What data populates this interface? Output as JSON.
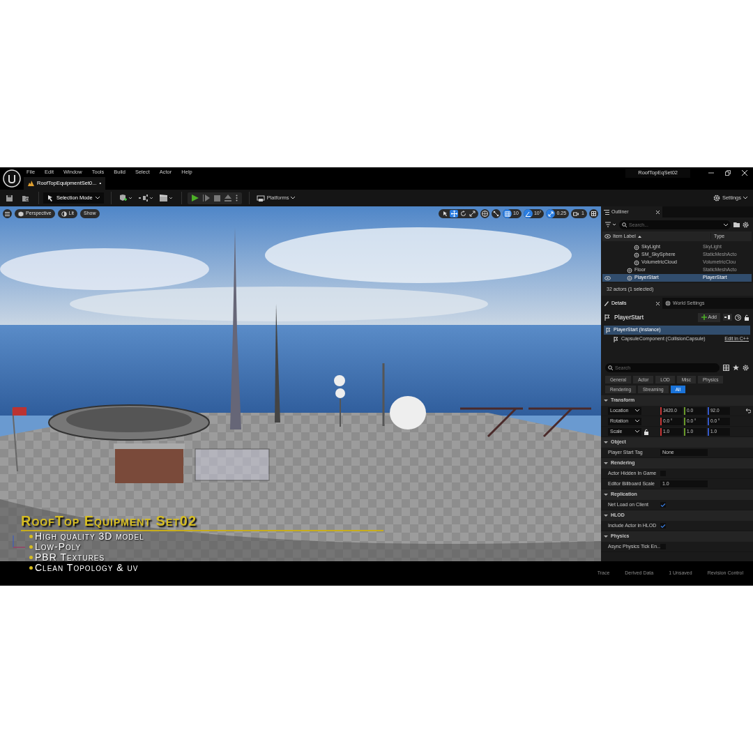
{
  "window": {
    "title": "RoofTopEqSet02",
    "tab": {
      "label": "RoofTopEquipmentSet0...",
      "unsaved_mark": "•"
    }
  },
  "menu": [
    "File",
    "Edit",
    "Window",
    "Tools",
    "Build",
    "Select",
    "Actor",
    "Help"
  ],
  "toolbar": {
    "mode": "Selection Mode",
    "platforms": "Platforms",
    "settings": "Settings"
  },
  "viewport": {
    "view_buttons": [
      "Perspective",
      "Lit",
      "Show"
    ],
    "transform_tools": [
      {
        "kind": "select",
        "selected": false
      },
      {
        "kind": "move",
        "selected": true
      },
      {
        "kind": "rotate",
        "selected": false
      },
      {
        "kind": "scale",
        "selected": false
      }
    ],
    "snaps": [
      {
        "kind": "grid",
        "value": "10"
      },
      {
        "kind": "angle",
        "value": "10°"
      },
      {
        "kind": "scale",
        "value": "0.25"
      },
      {
        "kind": "camera",
        "value": "1"
      }
    ],
    "overlay": {
      "title": "RoofTop Equipment Set02",
      "bullets": [
        "High quality 3D model",
        "Low-Poly",
        "PBR Textures",
        "Clean Topology & uv"
      ]
    }
  },
  "outliner": {
    "title": "Outliner",
    "search_placeholder": "Search...",
    "columns": [
      "Item Label",
      "Type"
    ],
    "rows": [
      {
        "children": [
          {
            "label": "SkyLight",
            "type": "SkyLight",
            "selected": false
          },
          {
            "label": "SM_SkySphere",
            "type": "StaticMeshActo",
            "selected": false
          },
          {
            "label": "VolumetricCloud",
            "type": "VolumetricClou",
            "selected": false
          }
        ]
      },
      {
        "label": "Floor",
        "type": "StaticMeshActo",
        "selected": false
      },
      {
        "label": "PlayerStart",
        "type": "PlayerStart",
        "selected": true
      }
    ],
    "status": "32 actors (1 selected)"
  },
  "details": {
    "tabs": [
      {
        "label": "Details",
        "selected": true
      },
      {
        "label": "World Settings",
        "selected": false
      }
    ],
    "actor": "PlayerStart",
    "add": "Add",
    "components": [
      {
        "label": "PlayerStart (Instance)",
        "selected": true
      },
      {
        "label": "CapsuleComponent (CollisionCapsule)",
        "selected": false
      }
    ],
    "edit_link": "Edit in C++",
    "search_placeholder": "Search",
    "filters": [
      {
        "label": "General",
        "selected": false
      },
      {
        "label": "Actor",
        "selected": false
      },
      {
        "label": "LOD",
        "selected": false
      },
      {
        "label": "Misc",
        "selected": false
      },
      {
        "label": "Physics",
        "selected": false
      },
      {
        "label": "Rendering",
        "selected": false
      },
      {
        "label": "Streaming",
        "selected": false
      },
      {
        "label": "All",
        "selected": true
      }
    ],
    "sections": [
      {
        "title": "Transform",
        "rows": [
          {
            "kind": "vector",
            "label": "Location",
            "values": [
              "3420.0",
              "0.0",
              "92.0"
            ],
            "reset": true,
            "lock": false
          },
          {
            "kind": "vector",
            "label": "Rotation",
            "values": [
              "0.0 °",
              "0.0 °",
              "0.0 °"
            ],
            "reset": false,
            "lock": false
          },
          {
            "kind": "vector",
            "label": "Scale",
            "values": [
              "1.0",
              "1.0",
              "1.0"
            ],
            "reset": false,
            "lock": true
          }
        ]
      },
      {
        "title": "Object",
        "rows": [
          {
            "kind": "text",
            "label": "Player Start Tag",
            "value": "None"
          }
        ]
      },
      {
        "title": "Rendering",
        "rows": [
          {
            "kind": "checkbox",
            "label": "Actor Hidden In Game",
            "checked": false
          },
          {
            "kind": "text",
            "label": "Editor Billboard Scale",
            "value": "1.0"
          }
        ]
      },
      {
        "title": "Replication",
        "rows": [
          {
            "kind": "checkbox",
            "label": "Net Load on Client",
            "checked": true
          }
        ]
      },
      {
        "title": "HLOD",
        "rows": [
          {
            "kind": "checkbox",
            "label": "Include Actor in HLOD",
            "checked": true
          }
        ]
      },
      {
        "title": "Physics",
        "rows": [
          {
            "kind": "checkbox",
            "label": "Async Physics Tick En...",
            "checked": false
          }
        ]
      }
    ]
  },
  "status_bar": [
    "Trace",
    "Derived Data",
    "1 Unsaved",
    "Revision Control"
  ]
}
